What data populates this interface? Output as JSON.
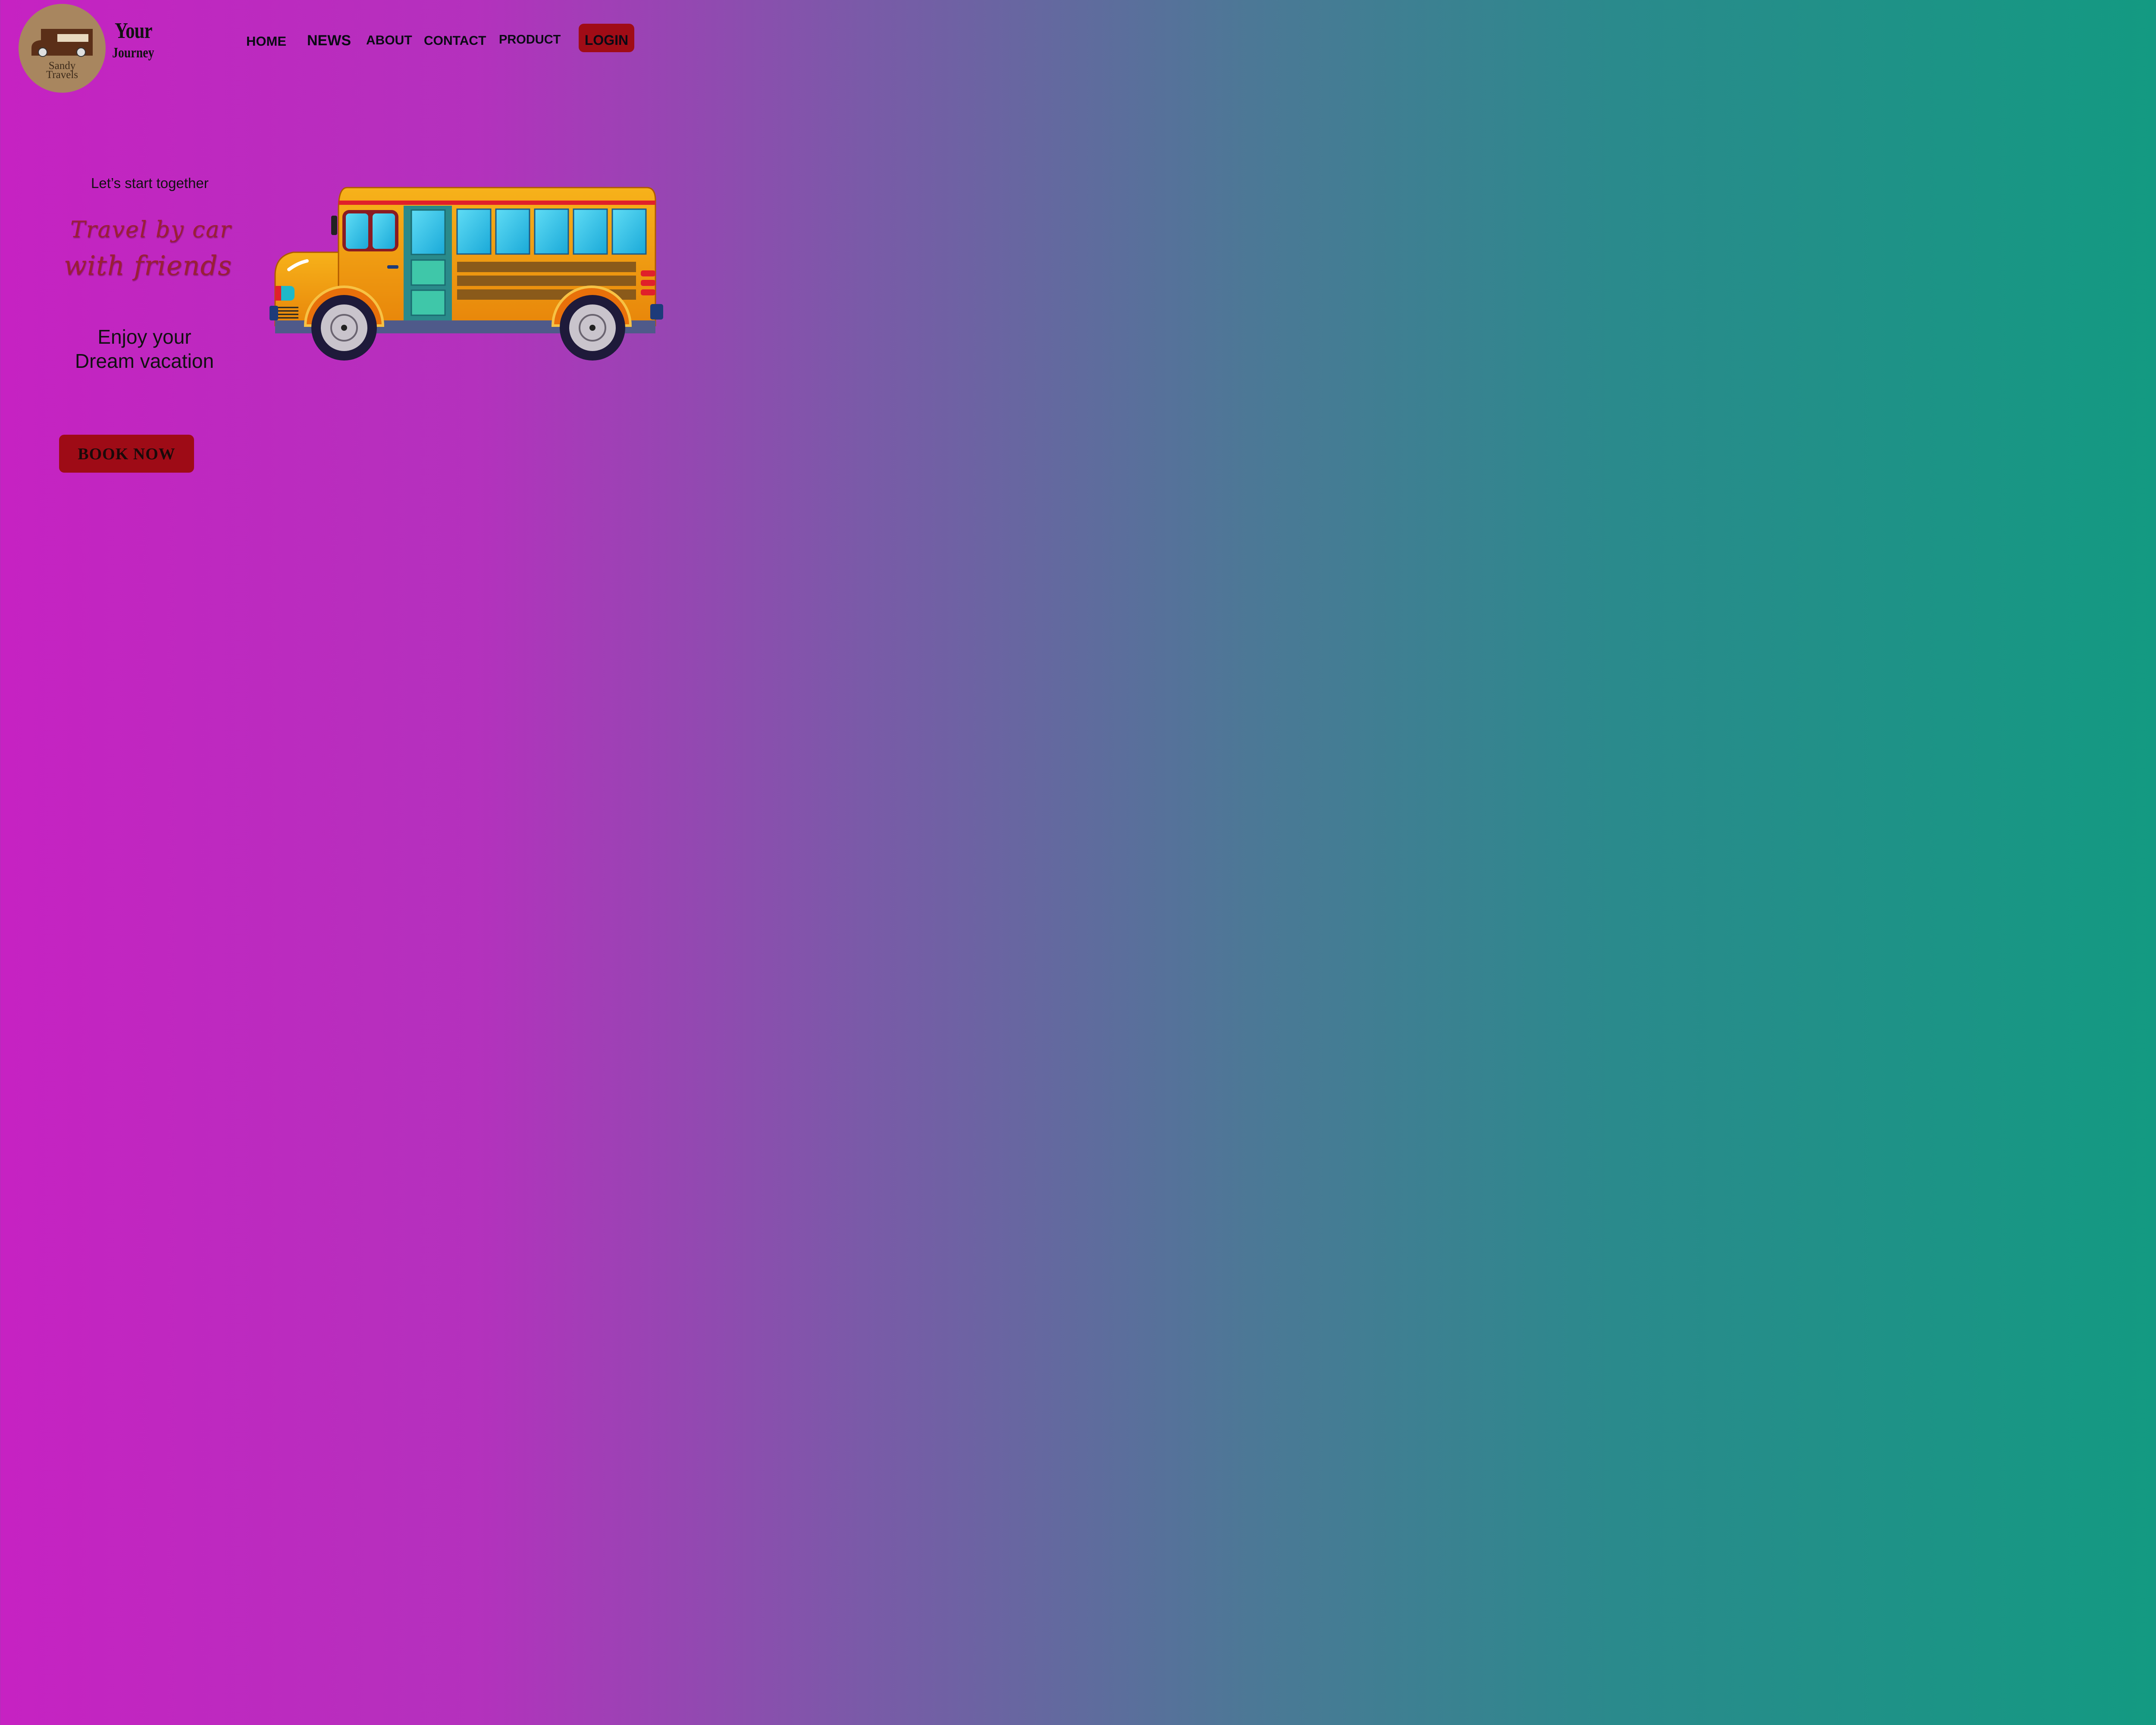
{
  "logo": {
    "line1": "Sandy",
    "line2": "Travels",
    "icon": "van-icon"
  },
  "brand": {
    "line1": "Your",
    "line2": "Journey"
  },
  "nav": {
    "home": "HOME",
    "news": "NEWS",
    "about": "ABOUT",
    "contact": "CONTACT",
    "product": "PRODUCT",
    "login": "LOGIN"
  },
  "hero": {
    "tagline": "Let’s start together",
    "headline_1": "Travel by car",
    "headline_2": "with friends",
    "sub_1": "Enjoy your",
    "sub_2": "Dream vacation",
    "cta": "BOOK NOW",
    "illustration": "school-bus-illustration"
  },
  "colors": {
    "accent": "#a00c16",
    "logo_bg": "#a8865f",
    "headline": "#9b1f36",
    "bus": "#f2a50c"
  }
}
